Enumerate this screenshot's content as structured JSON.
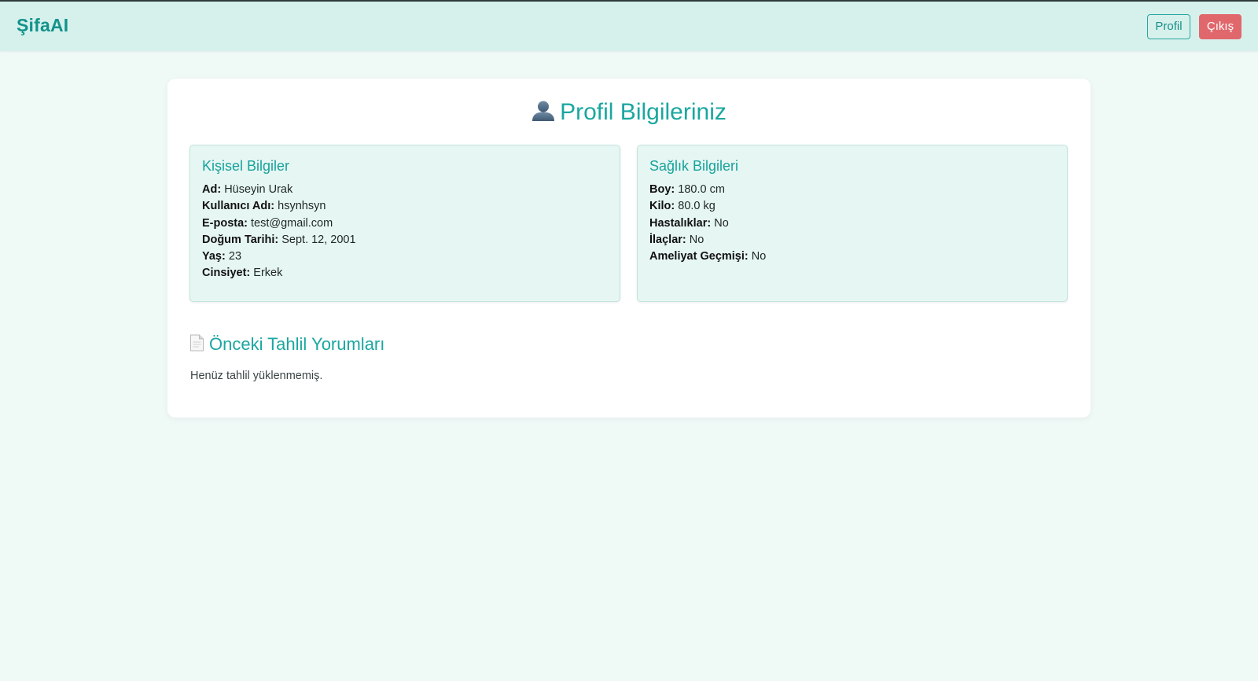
{
  "header": {
    "brand": "ŞifaAI",
    "profile_label": "Profil",
    "logout_label": "Çıkış"
  },
  "page": {
    "title": "Profil Bilgileriniz",
    "title_icon": "user-icon"
  },
  "personal": {
    "title": "Kişisel Bilgiler",
    "fields": [
      {
        "label": "Ad:",
        "value": "Hüseyin Urak"
      },
      {
        "label": "Kullanıcı Adı:",
        "value": "hsynhsyn"
      },
      {
        "label": "E-posta:",
        "value": "test@gmail.com"
      },
      {
        "label": "Doğum Tarihi:",
        "value": "Sept. 12, 2001"
      },
      {
        "label": "Yaş:",
        "value": "23"
      },
      {
        "label": "Cinsiyet:",
        "value": "Erkek"
      }
    ]
  },
  "health": {
    "title": "Sağlık Bilgileri",
    "fields": [
      {
        "label": "Boy:",
        "value": "180.0 cm"
      },
      {
        "label": "Kilo:",
        "value": "80.0 kg"
      },
      {
        "label": "Hastalıklar:",
        "value": "No"
      },
      {
        "label": "İlaçlar:",
        "value": "No"
      },
      {
        "label": "Ameliyat Geçmişi:",
        "value": "No"
      }
    ]
  },
  "history": {
    "title": "Önceki Tahlil Yorumları",
    "title_icon": "document-icon",
    "empty_message": "Henüz tahlil yüklenmemiş."
  },
  "colors": {
    "accent": "#1aa7a0",
    "header_bg": "#d6f1ec",
    "page_bg": "#eff9f6",
    "logout": "#e0686d"
  }
}
